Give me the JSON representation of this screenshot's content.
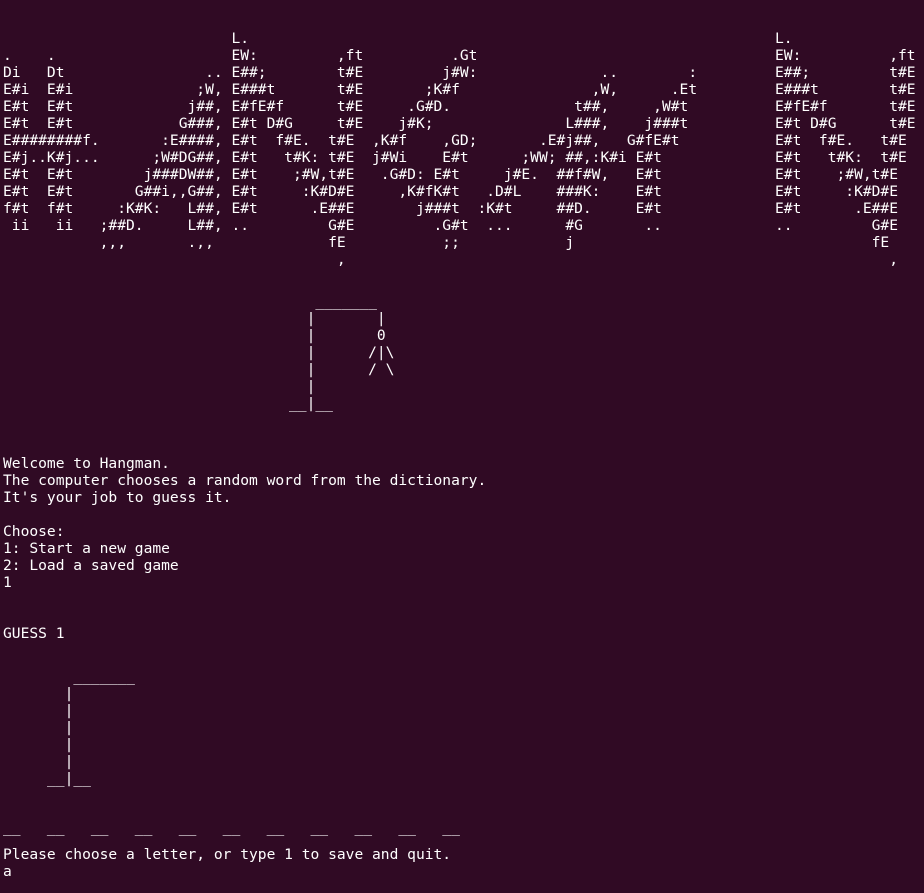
{
  "banner": {
    "left_art": "                          L.                                                                   \n.    .                    EW:         ,ft          .Gt                                     \nDi   Dt                .. E##;        t#E         j#W:              ..        :            \nE#i  E#i              ;W, E###t       t#E       ;K#f               ,W,      .Et            \nE#t  E#t             j##, E#fE#f      t#E     .G#D.              t##,     ,W#t             \nE#t  E#t            G###, E#t D#G     t#E    j#K;               L###,    j###t             \nE########f.       :E####, E#t  f#E.  t#E  ,K#f    ,GD;       .E#j##,   G#fE#t             \nE#j..K#j...      ;W#DG##, E#t   t#K: t#E  j#Wi    E#t      ;WW; ##,:K#i E#t              \nE#t  E#t        j###DW##, E#t    ;#W,t#E   .G#D: E#t     j#E.  ##f#W,   E#t              \nE#t  E#t       G##i,,G##, E#t     :K#D#E     ,K#fK#t   .D#L    ###K:    E#t              \nf#t  f#t     :K#K:   L##, E#t      .E##E       j###t  :K#t     ##D.     E#t              \n ii   ii   ;##D.     L##, ..         G#E         .G#t  ...      #G       ..              \n           ,,,       .,,             fE           ;;            j                        \n                                      ,                                                  ",
    "right_art": "L.              \nEW:          ,ft\nE##;         t#E\nE###t        t#E\nE#fE#f       t#E\nE#t D#G      t#E\nE#t  f#E.   t#E\nE#t   t#K:  t#E\nE#t    ;#W,t#E\nE#t     :K#D#E\nE#t      .E##E\n..         G#E\n           fE \n             , "
  },
  "gallows_top_art": "   _______\n  |       |\n  |       0\n  |      /|\\\n  |      / \\\n  |\n__|__",
  "welcome": {
    "line1": "Welcome to Hangman.",
    "line2": "The computer chooses a random word from the dictionary.",
    "line3": "It's your job to guess it."
  },
  "menu": {
    "choose": "Choose:",
    "option1": "1: Start a new game",
    "option2": "2: Load a saved game",
    "input": "1"
  },
  "guess": {
    "title": "GUESS 1",
    "gallows_art": "   _______\n  |\n  |\n  |\n  |\n  |\n__|__",
    "word_blanks": "__   __   __   __   __   __   __   __   __   __   __",
    "prompt": "Please choose a letter, or type 1 to save and quit.",
    "input": "a"
  }
}
